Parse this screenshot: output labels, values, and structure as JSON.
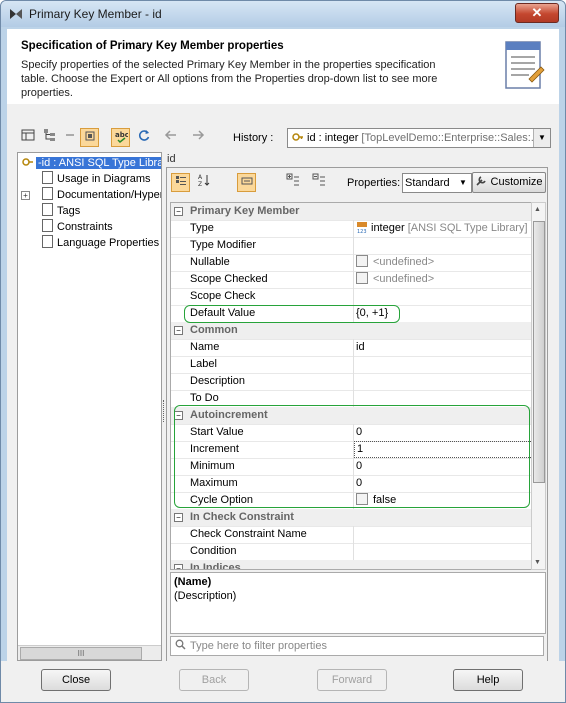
{
  "window": {
    "title": "Primary Key Member - id",
    "close_glyph": "✕"
  },
  "header": {
    "title": "Specification of Primary Key Member properties",
    "description": "Specify properties of the selected Primary Key Member in the properties specification table. Choose the Expert or All options from the Properties drop-down list to see more properties."
  },
  "toolbar": {
    "history_label": "History :",
    "history_value_main": "id : integer",
    "history_value_path": " [TopLevelDemo::Enterprise::Sales:..."
  },
  "tree": {
    "items": [
      {
        "label": "-id : ANSI SQL Type Library"
      },
      {
        "label": "Usage in Diagrams"
      },
      {
        "label": "Documentation/Hyperlinks"
      },
      {
        "label": "Tags"
      },
      {
        "label": "Constraints"
      },
      {
        "label": "Language Properties"
      }
    ],
    "scroll_grip": "III"
  },
  "right": {
    "panel_title": "id",
    "properties_label": "Properties:",
    "properties_value": "Standard",
    "customize_label": "Customize"
  },
  "grid": {
    "rows": [
      {
        "kind": "group",
        "label": "Primary Key Member",
        "toggle": "−"
      },
      {
        "kind": "prop",
        "label": "Type",
        "value": "integer",
        "value_extra": " [ANSI SQL Type Library]"
      },
      {
        "kind": "prop",
        "label": "Type Modifier",
        "value": ""
      },
      {
        "kind": "prop",
        "label": "Nullable",
        "value": "<undefined>"
      },
      {
        "kind": "prop",
        "label": "Scope Checked",
        "value": "<undefined>"
      },
      {
        "kind": "prop",
        "label": "Scope Check",
        "value": ""
      },
      {
        "kind": "prop",
        "label": "Default Value",
        "value": "{0, +1}"
      },
      {
        "kind": "group",
        "label": "Common",
        "toggle": "−"
      },
      {
        "kind": "prop",
        "label": "Name",
        "value": "id"
      },
      {
        "kind": "prop",
        "label": "Label",
        "value": ""
      },
      {
        "kind": "prop",
        "label": "Description",
        "value": ""
      },
      {
        "kind": "prop",
        "label": "To Do",
        "value": ""
      },
      {
        "kind": "group",
        "label": "Autoincrement",
        "toggle": "−"
      },
      {
        "kind": "prop",
        "label": "Start Value",
        "value": "0"
      },
      {
        "kind": "prop",
        "label": "Increment",
        "value": "1"
      },
      {
        "kind": "prop",
        "label": "Minimum",
        "value": "0"
      },
      {
        "kind": "prop",
        "label": "Maximum",
        "value": "0"
      },
      {
        "kind": "prop",
        "label": "Cycle Option",
        "value": "false"
      },
      {
        "kind": "group",
        "label": "In Check Constraint",
        "toggle": "−"
      },
      {
        "kind": "prop",
        "label": "Check Constraint Name",
        "value": ""
      },
      {
        "kind": "prop",
        "label": "Condition",
        "value": ""
      },
      {
        "kind": "group",
        "label": "In Indices",
        "toggle": "−"
      }
    ]
  },
  "description_panel": {
    "name": "(Name)",
    "text": "(Description)"
  },
  "filter": {
    "placeholder": "Type here to filter properties"
  },
  "buttons": {
    "close": "Close",
    "back": "Back",
    "forward": "Forward",
    "help": "Help"
  },
  "colors": {
    "selection": "#3875d7",
    "highlight_frame": "#27a33a",
    "toolbar_active": "#fbd89a"
  }
}
